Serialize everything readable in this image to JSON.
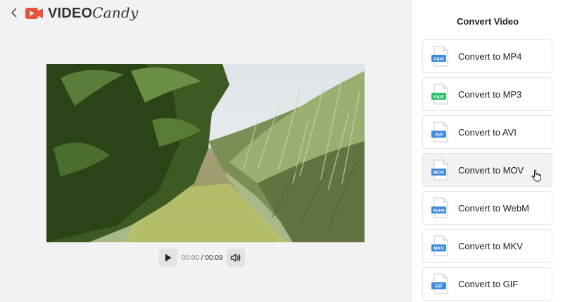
{
  "header": {
    "logo_bold": "VIDEO",
    "logo_script": "Candy"
  },
  "player": {
    "current_time": "00:00",
    "separator": " / ",
    "duration": "00:09"
  },
  "panel": {
    "title": "Convert Video",
    "options": [
      {
        "label": "Convert to MP4",
        "badge": "mp4",
        "color": "#3f8bdc",
        "hovered": false
      },
      {
        "label": "Convert to MP3",
        "badge": "mp3",
        "color": "#2fbf66",
        "hovered": false
      },
      {
        "label": "Convert to AVI",
        "badge": "AVI",
        "color": "#3f8bdc",
        "hovered": false
      },
      {
        "label": "Convert to MOV",
        "badge": "MOV",
        "color": "#3f8bdc",
        "hovered": true
      },
      {
        "label": "Convert to WebM",
        "badge": "WebM",
        "color": "#3f8bdc",
        "hovered": false
      },
      {
        "label": "Convert to MKV",
        "badge": "MKV",
        "color": "#3f8bdc",
        "hovered": false
      },
      {
        "label": "Convert to GIF",
        "badge": "GIF",
        "color": "#3f8bdc",
        "hovered": false
      }
    ]
  },
  "colors": {
    "brand": "#e8553e",
    "panel_bg": "#ffffff",
    "main_bg": "#f2f2f2"
  }
}
